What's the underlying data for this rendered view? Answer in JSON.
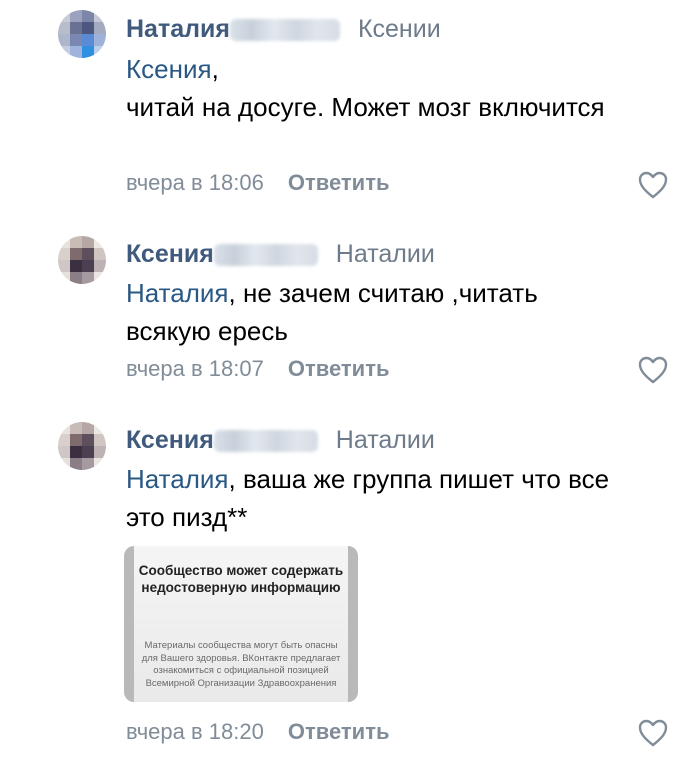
{
  "comments": [
    {
      "author": "Наталия",
      "reply_to": "Ксении",
      "mention": "Ксения",
      "text": ",",
      "text_line2": "читай на досуге. Может мозг включится",
      "date": "вчера в 18:06",
      "reply_label": "Ответить"
    },
    {
      "author": "Ксения",
      "reply_to": "Наталии",
      "mention": "Наталия",
      "text": ", не зачем считаю ,читать всякую ересь",
      "date": "вчера в 18:07",
      "reply_label": "Ответить"
    },
    {
      "author": "Ксения",
      "reply_to": "Наталии",
      "mention": "Наталия",
      "text": ", ваша же группа пишет что все это пизд**",
      "date": "вчера в 18:20",
      "reply_label": "Ответить",
      "attachment": {
        "title": "Сообщество может содержать недостоверную информацию",
        "body": "Материалы сообщества могут быть опасны для Вашего здоровья. ВКонтакте предлагает ознакомиться с официальной позицией Всемирной Организации Здравоохранения"
      }
    }
  ],
  "colors": {
    "author": "#3f5a7c",
    "mention": "#2a5885",
    "meta": "#818c99"
  },
  "icons": {
    "like": "heart-outline-icon"
  }
}
